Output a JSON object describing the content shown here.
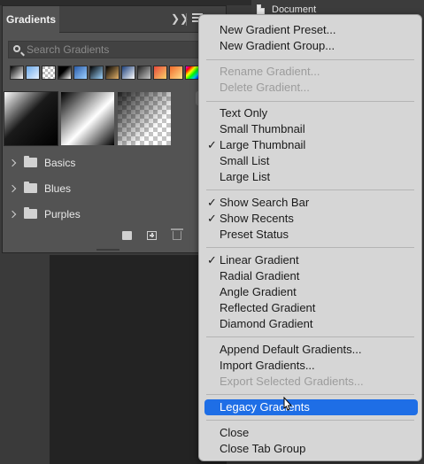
{
  "document_tab": {
    "label": "Document"
  },
  "panel": {
    "title": "Gradients",
    "collapse_icon": "double-chevron-right-icon",
    "menu_icon": "hamburger-menu-icon",
    "search": {
      "placeholder": "Search Gradients",
      "value": ""
    },
    "folders": [
      {
        "label": "Basics"
      },
      {
        "label": "Blues"
      },
      {
        "label": "Purples"
      }
    ]
  },
  "menu": {
    "items": [
      {
        "label": "New Gradient Preset...",
        "checked": false,
        "disabled": false
      },
      {
        "label": "New Gradient Group...",
        "checked": false,
        "disabled": false
      },
      {
        "label": "Rename Gradient...",
        "checked": false,
        "disabled": true
      },
      {
        "label": "Delete Gradient...",
        "checked": false,
        "disabled": true
      },
      {
        "label": "Text Only",
        "checked": false,
        "disabled": false
      },
      {
        "label": "Small Thumbnail",
        "checked": false,
        "disabled": false
      },
      {
        "label": "Large Thumbnail",
        "checked": true,
        "disabled": false
      },
      {
        "label": "Small List",
        "checked": false,
        "disabled": false
      },
      {
        "label": "Large List",
        "checked": false,
        "disabled": false
      },
      {
        "label": "Show Search Bar",
        "checked": true,
        "disabled": false
      },
      {
        "label": "Show Recents",
        "checked": true,
        "disabled": false
      },
      {
        "label": "Preset Status",
        "checked": false,
        "disabled": false
      },
      {
        "label": "Linear Gradient",
        "checked": true,
        "disabled": false
      },
      {
        "label": "Radial Gradient",
        "checked": false,
        "disabled": false
      },
      {
        "label": "Angle Gradient",
        "checked": false,
        "disabled": false
      },
      {
        "label": "Reflected Gradient",
        "checked": false,
        "disabled": false
      },
      {
        "label": "Diamond Gradient",
        "checked": false,
        "disabled": false
      },
      {
        "label": "Append Default Gradients...",
        "checked": false,
        "disabled": false
      },
      {
        "label": "Import Gradients...",
        "checked": false,
        "disabled": false
      },
      {
        "label": "Export Selected Gradients...",
        "checked": false,
        "disabled": true
      },
      {
        "label": "Legacy Gradients",
        "checked": false,
        "disabled": false,
        "highlighted": true
      },
      {
        "label": "Close",
        "checked": false,
        "disabled": false
      },
      {
        "label": "Close Tab Group",
        "checked": false,
        "disabled": false
      }
    ],
    "check_glyph": "✓"
  },
  "colors": {
    "highlight": "#1e6ee6",
    "menu_bg": "#d6d6d6",
    "panel_bg": "#535353"
  }
}
